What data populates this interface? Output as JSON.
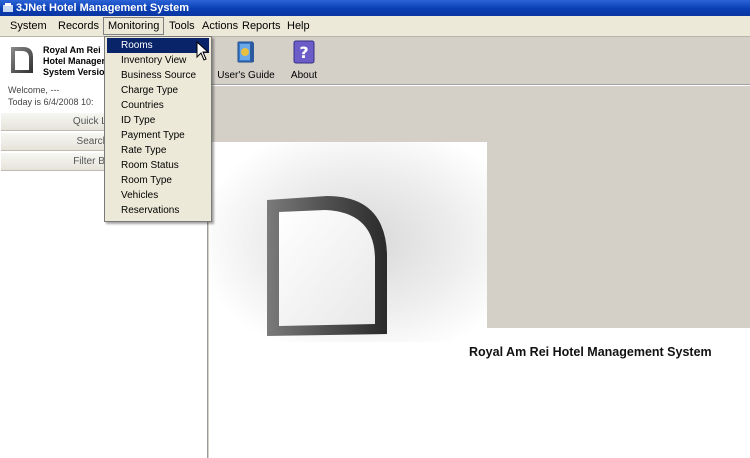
{
  "window": {
    "title": "3JNet Hotel Management System"
  },
  "menubar": {
    "items": [
      {
        "label": "System"
      },
      {
        "label": "Records"
      },
      {
        "label": "Monitoring"
      },
      {
        "label": "Tools"
      },
      {
        "label": "Actions"
      },
      {
        "label": "Reports"
      },
      {
        "label": "Help"
      }
    ]
  },
  "monitoring_menu": {
    "items": [
      {
        "label": "Rooms"
      },
      {
        "label": "Inventory View"
      },
      {
        "label": "Business Source"
      },
      {
        "label": "Charge Type"
      },
      {
        "label": "Countries"
      },
      {
        "label": "ID Type"
      },
      {
        "label": "Payment Type"
      },
      {
        "label": "Rate Type"
      },
      {
        "label": "Room Status"
      },
      {
        "label": "Room Type"
      },
      {
        "label": "Vehicles"
      },
      {
        "label": "Reservations"
      }
    ],
    "selected": "Rooms"
  },
  "sidebar": {
    "app_name_line1": "Royal Am Rei",
    "app_name_line2": "Hotel Manager",
    "app_name_line3": "System Versio",
    "welcome": "Welcome, ---",
    "today": "Today is  6/4/2008 10:",
    "buttons": [
      {
        "label": "Quick Launch"
      },
      {
        "label": "Search Item"
      },
      {
        "label": "Filter By Date"
      }
    ]
  },
  "toolbar": {
    "buttons": [
      {
        "label": "User's Guide",
        "icon": "book-icon"
      },
      {
        "label": "About",
        "icon": "question-icon"
      }
    ]
  },
  "main": {
    "brand": "Royal Am Rei Hotel Management System"
  },
  "colors": {
    "titlebar": "#0a3fb4",
    "selection": "#0a246a",
    "panel": "#d4d0c8",
    "menu": "#ece9d8"
  }
}
